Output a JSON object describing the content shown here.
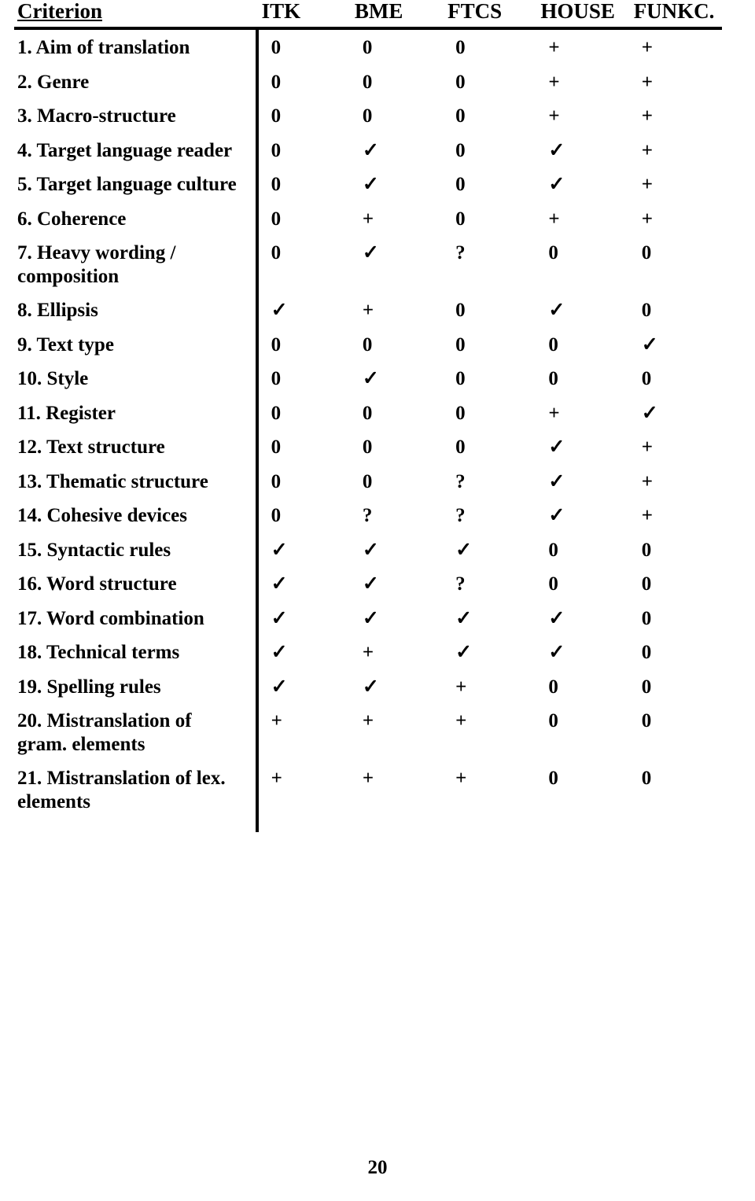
{
  "table": {
    "header": {
      "criterion": "Criterion",
      "columns": [
        "ITK",
        "BME",
        "FTCS",
        "HOUSE",
        "FUNKC."
      ]
    },
    "rows": [
      {
        "label": "1. Aim of translation",
        "values": [
          "0",
          "0",
          "0",
          "+",
          "+"
        ]
      },
      {
        "label": "2. Genre",
        "values": [
          "0",
          "0",
          "0",
          "+",
          "+"
        ]
      },
      {
        "label": "3. Macro-structure",
        "values": [
          "0",
          "0",
          "0",
          "+",
          "+"
        ]
      },
      {
        "label": "4. Target language reader",
        "values": [
          "0",
          "✓",
          "0",
          "✓",
          "+"
        ]
      },
      {
        "label": "5. Target language culture",
        "values": [
          "0",
          "✓",
          "0",
          "✓",
          "+"
        ]
      },
      {
        "label": "6. Coherence",
        "values": [
          "0",
          "+",
          "0",
          "+",
          "+"
        ]
      },
      {
        "label": "7. Heavy wording / composition",
        "values": [
          "0",
          "✓",
          "?",
          "0",
          "0"
        ]
      },
      {
        "label": "8. Ellipsis",
        "values": [
          "✓",
          "+",
          "0",
          "✓",
          "0"
        ]
      },
      {
        "label": "9. Text type",
        "values": [
          "0",
          "0",
          "0",
          "0",
          "✓"
        ]
      },
      {
        "label": "10. Style",
        "values": [
          "0",
          "✓",
          "0",
          "0",
          "0"
        ]
      },
      {
        "label": "11. Register",
        "values": [
          "0",
          "0",
          "0",
          "+",
          "✓"
        ]
      },
      {
        "label": "12. Text structure",
        "values": [
          "0",
          "0",
          "0",
          "✓",
          "+"
        ]
      },
      {
        "label": "13. Thematic structure",
        "values": [
          "0",
          "0",
          "?",
          "✓",
          "+"
        ]
      },
      {
        "label": "14. Cohesive devices",
        "values": [
          "0",
          "?",
          "?",
          "✓",
          "+"
        ]
      },
      {
        "label": "15. Syntactic rules",
        "values": [
          "✓",
          "✓",
          "✓",
          "0",
          "0"
        ]
      },
      {
        "label": "16. Word structure",
        "values": [
          "✓",
          "✓",
          "?",
          "0",
          "0"
        ]
      },
      {
        "label": "17. Word combination",
        "values": [
          "✓",
          "✓",
          "✓",
          "✓",
          "0"
        ]
      },
      {
        "label": "18. Technical terms",
        "values": [
          "✓",
          "+",
          "✓",
          "✓",
          "0"
        ]
      },
      {
        "label": "19. Spelling rules",
        "values": [
          "✓",
          "✓",
          "+",
          "0",
          "0"
        ]
      },
      {
        "label": "20. Mistranslation of gram. elements",
        "values": [
          "+",
          "+",
          "+",
          "0",
          "0"
        ]
      },
      {
        "label": "21. Mistranslation of lex. elements",
        "values": [
          "+",
          "+",
          "+",
          "0",
          "0"
        ]
      }
    ]
  },
  "footer": {
    "page_number": "20"
  }
}
